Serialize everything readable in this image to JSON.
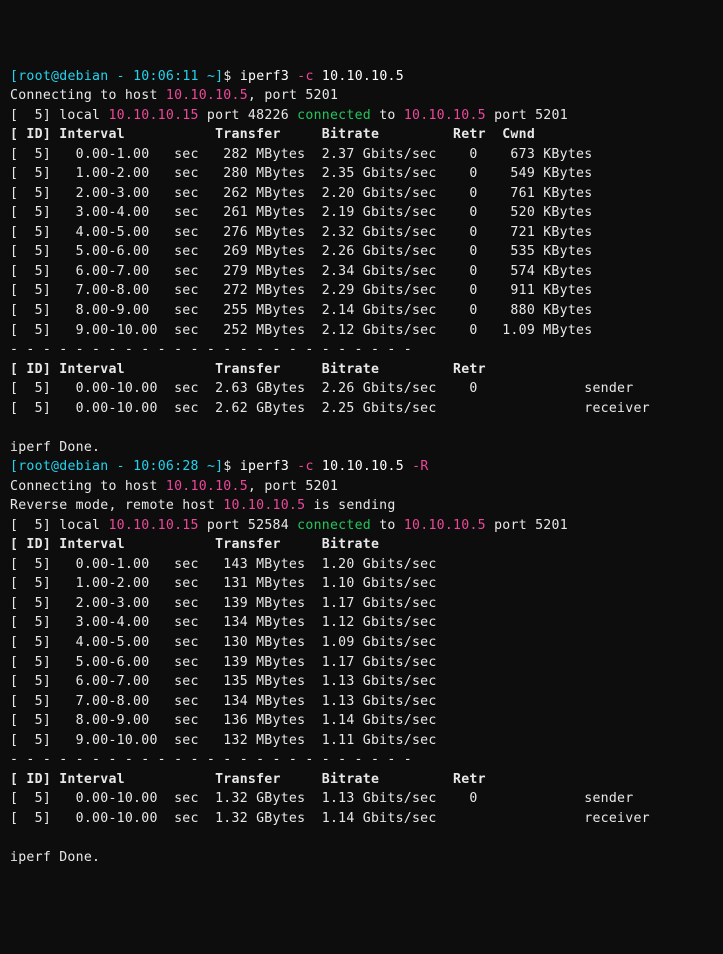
{
  "run1": {
    "prompt": {
      "user": "root",
      "host": "debian",
      "time": "10:06:11",
      "cwd": "~"
    },
    "cmd": {
      "bin": "iperf3",
      "flag": "-c",
      "target": "10.10.10.5"
    },
    "connect": {
      "pre": "Connecting to host ",
      "host": "10.10.10.5",
      "post": ", port 5201"
    },
    "local": {
      "id": "[  5]",
      "pre": " local ",
      "lip": "10.10.10.15",
      "mid": " port 48226 ",
      "conn": "connected",
      "to": " to ",
      "rip": "10.10.10.5",
      "post": " port 5201"
    },
    "hdr": "[ ID] Interval           Transfer     Bitrate         Retr  Cwnd",
    "rows": [
      {
        "id": "[  5]",
        "intv": "   0.00-1.00 ",
        "unit": "  sec",
        "xfer": "   282 MBytes",
        "rate": "  2.37 Gbits/sec",
        "retr": "    0",
        "cwnd": "    673 KBytes"
      },
      {
        "id": "[  5]",
        "intv": "   1.00-2.00 ",
        "unit": "  sec",
        "xfer": "   280 MBytes",
        "rate": "  2.35 Gbits/sec",
        "retr": "    0",
        "cwnd": "    549 KBytes"
      },
      {
        "id": "[  5]",
        "intv": "   2.00-3.00 ",
        "unit": "  sec",
        "xfer": "   262 MBytes",
        "rate": "  2.20 Gbits/sec",
        "retr": "    0",
        "cwnd": "    761 KBytes"
      },
      {
        "id": "[  5]",
        "intv": "   3.00-4.00 ",
        "unit": "  sec",
        "xfer": "   261 MBytes",
        "rate": "  2.19 Gbits/sec",
        "retr": "    0",
        "cwnd": "    520 KBytes"
      },
      {
        "id": "[  5]",
        "intv": "   4.00-5.00 ",
        "unit": "  sec",
        "xfer": "   276 MBytes",
        "rate": "  2.32 Gbits/sec",
        "retr": "    0",
        "cwnd": "    721 KBytes"
      },
      {
        "id": "[  5]",
        "intv": "   5.00-6.00 ",
        "unit": "  sec",
        "xfer": "   269 MBytes",
        "rate": "  2.26 Gbits/sec",
        "retr": "    0",
        "cwnd": "    535 KBytes"
      },
      {
        "id": "[  5]",
        "intv": "   6.00-7.00 ",
        "unit": "  sec",
        "xfer": "   279 MBytes",
        "rate": "  2.34 Gbits/sec",
        "retr": "    0",
        "cwnd": "    574 KBytes"
      },
      {
        "id": "[  5]",
        "intv": "   7.00-8.00 ",
        "unit": "  sec",
        "xfer": "   272 MBytes",
        "rate": "  2.29 Gbits/sec",
        "retr": "    0",
        "cwnd": "    911 KBytes"
      },
      {
        "id": "[  5]",
        "intv": "   8.00-9.00 ",
        "unit": "  sec",
        "xfer": "   255 MBytes",
        "rate": "  2.14 Gbits/sec",
        "retr": "    0",
        "cwnd": "    880 KBytes"
      },
      {
        "id": "[  5]",
        "intv": "   9.00-10.00",
        "unit": "  sec",
        "xfer": "   252 MBytes",
        "rate": "  2.12 Gbits/sec",
        "retr": "    0",
        "cwnd": "   1.09 MBytes"
      }
    ],
    "dash": "- - - - - - - - - - - - - - - - - - - - - - - - -",
    "sumhdr": "[ ID] Interval           Transfer     Bitrate         Retr",
    "sum": [
      {
        "id": "[  5]",
        "intv": "   0.00-10.00",
        "unit": "  sec",
        "xfer": "  2.63 GBytes",
        "rate": "  2.26 Gbits/sec",
        "retr": "    0",
        "role": "             sender"
      },
      {
        "id": "[  5]",
        "intv": "   0.00-10.00",
        "unit": "  sec",
        "xfer": "  2.62 GBytes",
        "rate": "  2.25 Gbits/sec",
        "retr": "     ",
        "role": "             receiver"
      }
    ],
    "done": "iperf Done."
  },
  "run2": {
    "prompt": {
      "user": "root",
      "host": "debian",
      "time": "10:06:28",
      "cwd": "~"
    },
    "cmd": {
      "bin": "iperf3",
      "flag1": "-c",
      "target": "10.10.10.5",
      "flag2": "-R"
    },
    "connect": {
      "pre": "Connecting to host ",
      "host": "10.10.10.5",
      "post": ", port 5201"
    },
    "reverse": {
      "pre": "Reverse mode, remote host ",
      "host": "10.10.10.5",
      "post": " is sending"
    },
    "local": {
      "id": "[  5]",
      "pre": " local ",
      "lip": "10.10.10.15",
      "mid": " port 52584 ",
      "conn": "connected",
      "to": " to ",
      "rip": "10.10.10.5",
      "post": " port 5201"
    },
    "hdr": "[ ID] Interval           Transfer     Bitrate",
    "rows": [
      {
        "id": "[  5]",
        "intv": "   0.00-1.00 ",
        "unit": "  sec",
        "xfer": "   143 MBytes",
        "rate": "  1.20 Gbits/sec"
      },
      {
        "id": "[  5]",
        "intv": "   1.00-2.00 ",
        "unit": "  sec",
        "xfer": "   131 MBytes",
        "rate": "  1.10 Gbits/sec"
      },
      {
        "id": "[  5]",
        "intv": "   2.00-3.00 ",
        "unit": "  sec",
        "xfer": "   139 MBytes",
        "rate": "  1.17 Gbits/sec"
      },
      {
        "id": "[  5]",
        "intv": "   3.00-4.00 ",
        "unit": "  sec",
        "xfer": "   134 MBytes",
        "rate": "  1.12 Gbits/sec"
      },
      {
        "id": "[  5]",
        "intv": "   4.00-5.00 ",
        "unit": "  sec",
        "xfer": "   130 MBytes",
        "rate": "  1.09 Gbits/sec"
      },
      {
        "id": "[  5]",
        "intv": "   5.00-6.00 ",
        "unit": "  sec",
        "xfer": "   139 MBytes",
        "rate": "  1.17 Gbits/sec"
      },
      {
        "id": "[  5]",
        "intv": "   6.00-7.00 ",
        "unit": "  sec",
        "xfer": "   135 MBytes",
        "rate": "  1.13 Gbits/sec"
      },
      {
        "id": "[  5]",
        "intv": "   7.00-8.00 ",
        "unit": "  sec",
        "xfer": "   134 MBytes",
        "rate": "  1.13 Gbits/sec"
      },
      {
        "id": "[  5]",
        "intv": "   8.00-9.00 ",
        "unit": "  sec",
        "xfer": "   136 MBytes",
        "rate": "  1.14 Gbits/sec"
      },
      {
        "id": "[  5]",
        "intv": "   9.00-10.00",
        "unit": "  sec",
        "xfer": "   132 MBytes",
        "rate": "  1.11 Gbits/sec"
      }
    ],
    "dash": "- - - - - - - - - - - - - - - - - - - - - - - - -",
    "sumhdr": "[ ID] Interval           Transfer     Bitrate         Retr",
    "sum": [
      {
        "id": "[  5]",
        "intv": "   0.00-10.00",
        "unit": "  sec",
        "xfer": "  1.32 GBytes",
        "rate": "  1.13 Gbits/sec",
        "retr": "    0",
        "role": "             sender"
      },
      {
        "id": "[  5]",
        "intv": "   0.00-10.00",
        "unit": "  sec",
        "xfer": "  1.32 GBytes",
        "rate": "  1.14 Gbits/sec",
        "retr": "     ",
        "role": "             receiver"
      }
    ],
    "done": "iperf Done."
  }
}
